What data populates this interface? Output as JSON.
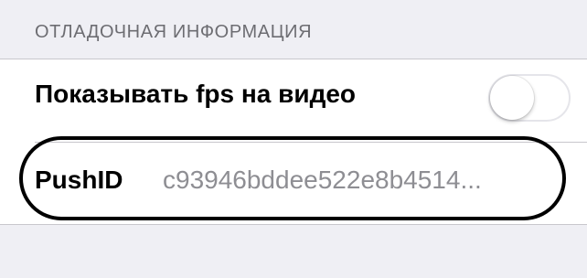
{
  "section": {
    "header": "ОТЛАДОЧНАЯ ИНФОРМАЦИЯ"
  },
  "rows": [
    {
      "label": "Показывать fps на видео",
      "toggle_state": "off"
    },
    {
      "label": "PushID",
      "value": "c93946bddee522e8b4514..."
    }
  ],
  "colors": {
    "background": "#efeff4",
    "cell": "#ffffff",
    "header_text": "#6d6d72",
    "value_text": "#8e8e93",
    "annotation": "#000000"
  }
}
